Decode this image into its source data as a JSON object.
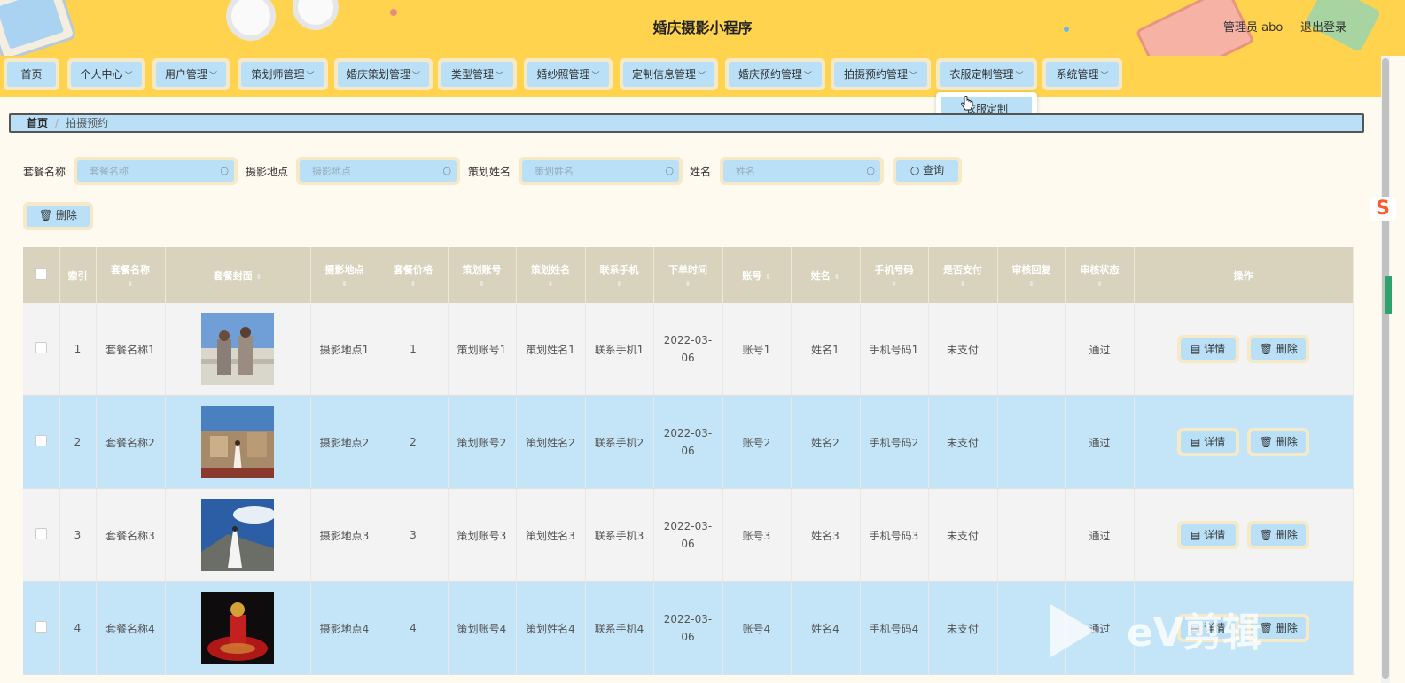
{
  "header": {
    "title": "婚庆摄影小程序",
    "user_label": "管理员 abo",
    "logout_label": "退出登录"
  },
  "nav": {
    "items": [
      {
        "label": "首页",
        "chevron": false
      },
      {
        "label": "个人中心",
        "chevron": true
      },
      {
        "label": "用户管理",
        "chevron": true
      },
      {
        "label": "策划师管理",
        "chevron": true
      },
      {
        "label": "婚庆策划管理",
        "chevron": true
      },
      {
        "label": "类型管理",
        "chevron": true
      },
      {
        "label": "婚纱照管理",
        "chevron": true
      },
      {
        "label": "定制信息管理",
        "chevron": true
      },
      {
        "label": "婚庆预约管理",
        "chevron": true
      },
      {
        "label": "拍摄预约管理",
        "chevron": true
      },
      {
        "label": "衣服定制管理",
        "chevron": true
      },
      {
        "label": "系统管理",
        "chevron": true
      }
    ],
    "dropdown_item": "衣服定制"
  },
  "breadcrumb": {
    "home": "首页",
    "sep": "/",
    "current": "拍摄预约"
  },
  "search": {
    "fields": [
      {
        "label": "套餐名称",
        "placeholder": "套餐名称"
      },
      {
        "label": "摄影地点",
        "placeholder": "摄影地点"
      },
      {
        "label": "策划姓名",
        "placeholder": "策划姓名"
      },
      {
        "label": "姓名",
        "placeholder": "姓名"
      }
    ],
    "query_label": "查询",
    "delete_label": "删除"
  },
  "table": {
    "headers": [
      "索引",
      "套餐名称",
      "套餐封面",
      "摄影地点",
      "套餐价格",
      "策划账号",
      "策划姓名",
      "联系手机",
      "下单时间",
      "账号",
      "姓名",
      "手机号码",
      "是否支付",
      "审核回复",
      "审核状态",
      "操作"
    ],
    "rows": [
      {
        "index": "1",
        "name": "套餐名称1",
        "location": "摄影地点1",
        "price": "1",
        "planner_account": "策划账号1",
        "planner_name": "策划姓名1",
        "contact": "联系手机1",
        "time": "2022-03-06",
        "account": "账号1",
        "username": "姓名1",
        "phone": "手机号码1",
        "paid": "未支付",
        "reply": "",
        "status": "通过"
      },
      {
        "index": "2",
        "name": "套餐名称2",
        "location": "摄影地点2",
        "price": "2",
        "planner_account": "策划账号2",
        "planner_name": "策划姓名2",
        "contact": "联系手机2",
        "time": "2022-03-06",
        "account": "账号2",
        "username": "姓名2",
        "phone": "手机号码2",
        "paid": "未支付",
        "reply": "",
        "status": "通过"
      },
      {
        "index": "3",
        "name": "套餐名称3",
        "location": "摄影地点3",
        "price": "3",
        "planner_account": "策划账号3",
        "planner_name": "策划姓名3",
        "contact": "联系手机3",
        "time": "2022-03-06",
        "account": "账号3",
        "username": "姓名3",
        "phone": "手机号码3",
        "paid": "未支付",
        "reply": "",
        "status": "通过"
      },
      {
        "index": "4",
        "name": "套餐名称4",
        "location": "摄影地点4",
        "price": "4",
        "planner_account": "策划账号4",
        "planner_name": "策划姓名4",
        "contact": "联系手机4",
        "time": "2022-03-06",
        "account": "账号4",
        "username": "姓名4",
        "phone": "手机号码4",
        "paid": "未支付",
        "reply": "",
        "status": "通过"
      }
    ],
    "detail_label": "详情",
    "delete_label": "删除"
  },
  "watermark": {
    "text": "eV剪辑"
  },
  "side_icon": {
    "text": "S"
  }
}
